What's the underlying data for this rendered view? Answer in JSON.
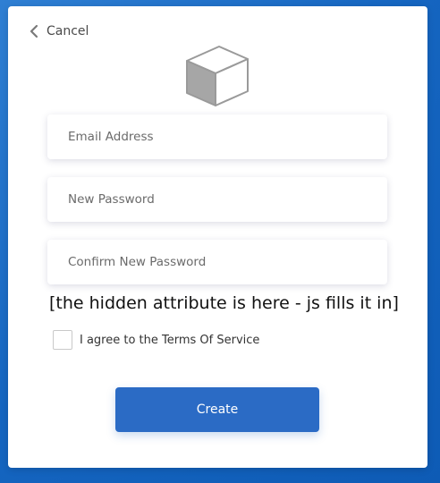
{
  "header": {
    "cancel_label": "Cancel"
  },
  "form": {
    "email_placeholder": "Email Address",
    "new_password_placeholder": "New Password",
    "confirm_password_placeholder": "Confirm New Password",
    "hidden_note": "[the hidden attribute is here - js fills it in]",
    "agree_label": "I agree to the Terms Of Service",
    "agree_checked": false,
    "create_label": "Create"
  },
  "colors": {
    "background": "#1565c0",
    "primary_button": "#2b6bc5",
    "card": "#ffffff"
  },
  "icons": {
    "cancel": "chevron-left-icon",
    "logo": "cube-logo-icon"
  }
}
